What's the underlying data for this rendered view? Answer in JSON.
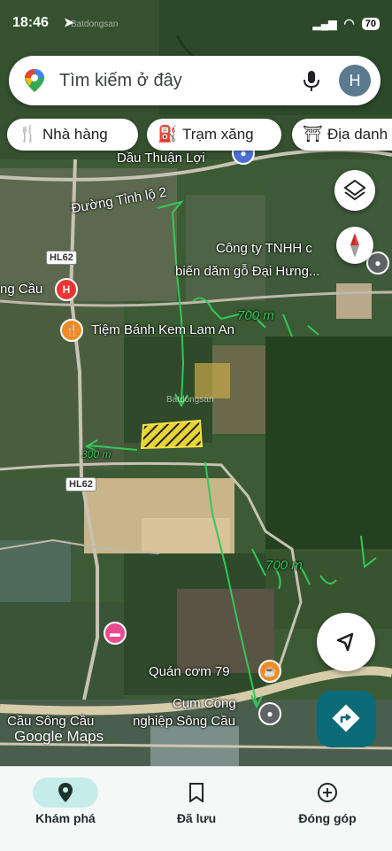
{
  "status_bar": {
    "time": "18:46",
    "battery": "70"
  },
  "search": {
    "placeholder": "Tìm kiếm ở đây",
    "avatar_letter": "H"
  },
  "chips": [
    {
      "label": "Nhà hàng",
      "icon": "fork-knife-icon"
    },
    {
      "label": "Trạm xăng",
      "icon": "gas-pump-icon"
    },
    {
      "label": "Địa danh",
      "icon": "landmark-icon"
    }
  ],
  "map": {
    "labels": {
      "dau": "Dầu Thuận Lợi",
      "duong": "Đường Tỉnh lộ 2",
      "congty": "Công ty TNHH c",
      "bien": "biến dăm gỗ Đại Hưng...",
      "songcau": "ng Cầu",
      "tiembanh": "Tiệm Bánh Kem Lam An",
      "quancom": "Quán cơm 79",
      "cumcong": "Cụm Công",
      "nghiep": "nghiệp Sông Cầu",
      "cauSong": "Cầu Sông Cầu",
      "hl62a": "HL62",
      "hl62b": "HL62",
      "batdongsan1": "Batdongsan",
      "batdongsan2": "Batdongsan"
    },
    "annotations": {
      "top": "700 m",
      "right": "700 m",
      "left": "300 m"
    },
    "google_logo": "Google Maps"
  },
  "bottom_nav": [
    {
      "label": "Khám phá",
      "icon": "explore-pin-icon",
      "active": true
    },
    {
      "label": "Đã lưu",
      "icon": "bookmark-icon",
      "active": false
    },
    {
      "label": "Đóng góp",
      "icon": "add-circle-icon",
      "active": false
    }
  ],
  "colors": {
    "accent": "#0b6b78",
    "active_tab_bg": "#c6ece9"
  }
}
